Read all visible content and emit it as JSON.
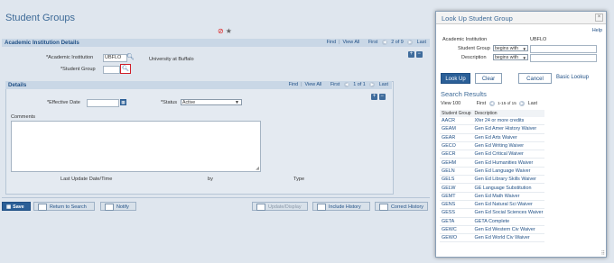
{
  "page": {
    "title": "Student Groups"
  },
  "institution": {
    "section_title": "Academic Institution Details",
    "nav": {
      "find": "Find",
      "view_all": "View All",
      "first": "First",
      "count": "2 of 9",
      "last": "Last"
    },
    "inst_label": "*Academic Institution",
    "inst_value": "UBFLO",
    "inst_desc": "University at Buffalo",
    "group_label": "*Student Group",
    "group_value": ""
  },
  "details": {
    "section_title": "Details",
    "nav": {
      "find": "Find",
      "view_all": "View All",
      "first": "First",
      "count": "1 of 1",
      "last": "Last"
    },
    "eff_date_label": "*Effective Date",
    "status_label": "*Status",
    "status_value": "Active",
    "comments_label": "Comments",
    "last_update_label": "Last Update Date/Time",
    "by_label": "by",
    "type_label": "Type"
  },
  "toolbar": {
    "save": "Save",
    "return": "Return to Search",
    "notify": "Notify",
    "update_display": "Update/Display",
    "include_history": "Include History",
    "correct_history": "Correct History"
  },
  "lookup": {
    "title": "Look Up Student Group",
    "help": "Help",
    "inst_label": "Academic Institution",
    "inst_value": "UBFLO",
    "group_label": "Student Group",
    "group_op": "begins with",
    "desc_label": "Description",
    "desc_op": "begins with",
    "btn_lookup": "Look Up",
    "btn_clear": "Clear",
    "btn_cancel": "Cancel",
    "basic_lookup": "Basic Lookup",
    "results_title": "Search Results",
    "view100": "View 100",
    "first": "First",
    "range": "1-15 of 15",
    "last": "Last",
    "col_group": "Student Group",
    "col_desc": "Description",
    "rows": [
      [
        "AACR",
        "Xfer 24 or more credits"
      ],
      [
        "GEAM",
        "Gen Ed Amer History Waiver"
      ],
      [
        "GEAR",
        "Gen Ed Arts Waiver"
      ],
      [
        "GECO",
        "Gen Ed Writing Waiver"
      ],
      [
        "GECR",
        "Gen Ed Critical Waiver"
      ],
      [
        "GEHM",
        "Gen Ed Humanities Waiver"
      ],
      [
        "GELN",
        "Gen Ed Language Waiver"
      ],
      [
        "GELS",
        "Gen Ed Library Skills Waiver"
      ],
      [
        "GELW",
        "GE Language Substitution"
      ],
      [
        "GEMT",
        "Gen Ed Math Waiver"
      ],
      [
        "GENS",
        "Gen Ed Natural Sci Waiver"
      ],
      [
        "GESS",
        "Gen Ed Social Sciences Waiver"
      ],
      [
        "GETA",
        "GETA Complete"
      ],
      [
        "GEWC",
        "Gen Ed Western Civ Waiver"
      ],
      [
        "GEWO",
        "Gen Ed World Civ Waiver"
      ]
    ]
  }
}
